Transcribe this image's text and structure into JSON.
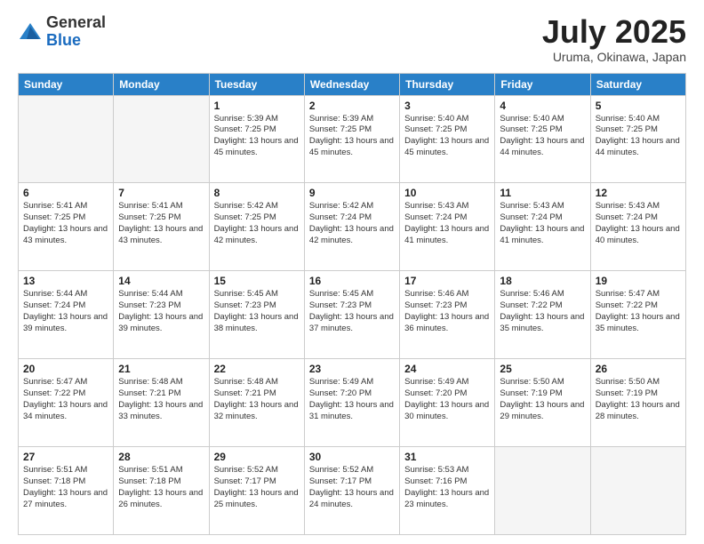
{
  "logo": {
    "general": "General",
    "blue": "Blue"
  },
  "header": {
    "month": "July 2025",
    "location": "Uruma, Okinawa, Japan"
  },
  "weekdays": [
    "Sunday",
    "Monday",
    "Tuesday",
    "Wednesday",
    "Thursday",
    "Friday",
    "Saturday"
  ],
  "weeks": [
    [
      {
        "day": "",
        "info": ""
      },
      {
        "day": "",
        "info": ""
      },
      {
        "day": "1",
        "info": "Sunrise: 5:39 AM\nSunset: 7:25 PM\nDaylight: 13 hours and 45 minutes."
      },
      {
        "day": "2",
        "info": "Sunrise: 5:39 AM\nSunset: 7:25 PM\nDaylight: 13 hours and 45 minutes."
      },
      {
        "day": "3",
        "info": "Sunrise: 5:40 AM\nSunset: 7:25 PM\nDaylight: 13 hours and 45 minutes."
      },
      {
        "day": "4",
        "info": "Sunrise: 5:40 AM\nSunset: 7:25 PM\nDaylight: 13 hours and 44 minutes."
      },
      {
        "day": "5",
        "info": "Sunrise: 5:40 AM\nSunset: 7:25 PM\nDaylight: 13 hours and 44 minutes."
      }
    ],
    [
      {
        "day": "6",
        "info": "Sunrise: 5:41 AM\nSunset: 7:25 PM\nDaylight: 13 hours and 43 minutes."
      },
      {
        "day": "7",
        "info": "Sunrise: 5:41 AM\nSunset: 7:25 PM\nDaylight: 13 hours and 43 minutes."
      },
      {
        "day": "8",
        "info": "Sunrise: 5:42 AM\nSunset: 7:25 PM\nDaylight: 13 hours and 42 minutes."
      },
      {
        "day": "9",
        "info": "Sunrise: 5:42 AM\nSunset: 7:24 PM\nDaylight: 13 hours and 42 minutes."
      },
      {
        "day": "10",
        "info": "Sunrise: 5:43 AM\nSunset: 7:24 PM\nDaylight: 13 hours and 41 minutes."
      },
      {
        "day": "11",
        "info": "Sunrise: 5:43 AM\nSunset: 7:24 PM\nDaylight: 13 hours and 41 minutes."
      },
      {
        "day": "12",
        "info": "Sunrise: 5:43 AM\nSunset: 7:24 PM\nDaylight: 13 hours and 40 minutes."
      }
    ],
    [
      {
        "day": "13",
        "info": "Sunrise: 5:44 AM\nSunset: 7:24 PM\nDaylight: 13 hours and 39 minutes."
      },
      {
        "day": "14",
        "info": "Sunrise: 5:44 AM\nSunset: 7:23 PM\nDaylight: 13 hours and 39 minutes."
      },
      {
        "day": "15",
        "info": "Sunrise: 5:45 AM\nSunset: 7:23 PM\nDaylight: 13 hours and 38 minutes."
      },
      {
        "day": "16",
        "info": "Sunrise: 5:45 AM\nSunset: 7:23 PM\nDaylight: 13 hours and 37 minutes."
      },
      {
        "day": "17",
        "info": "Sunrise: 5:46 AM\nSunset: 7:23 PM\nDaylight: 13 hours and 36 minutes."
      },
      {
        "day": "18",
        "info": "Sunrise: 5:46 AM\nSunset: 7:22 PM\nDaylight: 13 hours and 35 minutes."
      },
      {
        "day": "19",
        "info": "Sunrise: 5:47 AM\nSunset: 7:22 PM\nDaylight: 13 hours and 35 minutes."
      }
    ],
    [
      {
        "day": "20",
        "info": "Sunrise: 5:47 AM\nSunset: 7:22 PM\nDaylight: 13 hours and 34 minutes."
      },
      {
        "day": "21",
        "info": "Sunrise: 5:48 AM\nSunset: 7:21 PM\nDaylight: 13 hours and 33 minutes."
      },
      {
        "day": "22",
        "info": "Sunrise: 5:48 AM\nSunset: 7:21 PM\nDaylight: 13 hours and 32 minutes."
      },
      {
        "day": "23",
        "info": "Sunrise: 5:49 AM\nSunset: 7:20 PM\nDaylight: 13 hours and 31 minutes."
      },
      {
        "day": "24",
        "info": "Sunrise: 5:49 AM\nSunset: 7:20 PM\nDaylight: 13 hours and 30 minutes."
      },
      {
        "day": "25",
        "info": "Sunrise: 5:50 AM\nSunset: 7:19 PM\nDaylight: 13 hours and 29 minutes."
      },
      {
        "day": "26",
        "info": "Sunrise: 5:50 AM\nSunset: 7:19 PM\nDaylight: 13 hours and 28 minutes."
      }
    ],
    [
      {
        "day": "27",
        "info": "Sunrise: 5:51 AM\nSunset: 7:18 PM\nDaylight: 13 hours and 27 minutes."
      },
      {
        "day": "28",
        "info": "Sunrise: 5:51 AM\nSunset: 7:18 PM\nDaylight: 13 hours and 26 minutes."
      },
      {
        "day": "29",
        "info": "Sunrise: 5:52 AM\nSunset: 7:17 PM\nDaylight: 13 hours and 25 minutes."
      },
      {
        "day": "30",
        "info": "Sunrise: 5:52 AM\nSunset: 7:17 PM\nDaylight: 13 hours and 24 minutes."
      },
      {
        "day": "31",
        "info": "Sunrise: 5:53 AM\nSunset: 7:16 PM\nDaylight: 13 hours and 23 minutes."
      },
      {
        "day": "",
        "info": ""
      },
      {
        "day": "",
        "info": ""
      }
    ]
  ]
}
